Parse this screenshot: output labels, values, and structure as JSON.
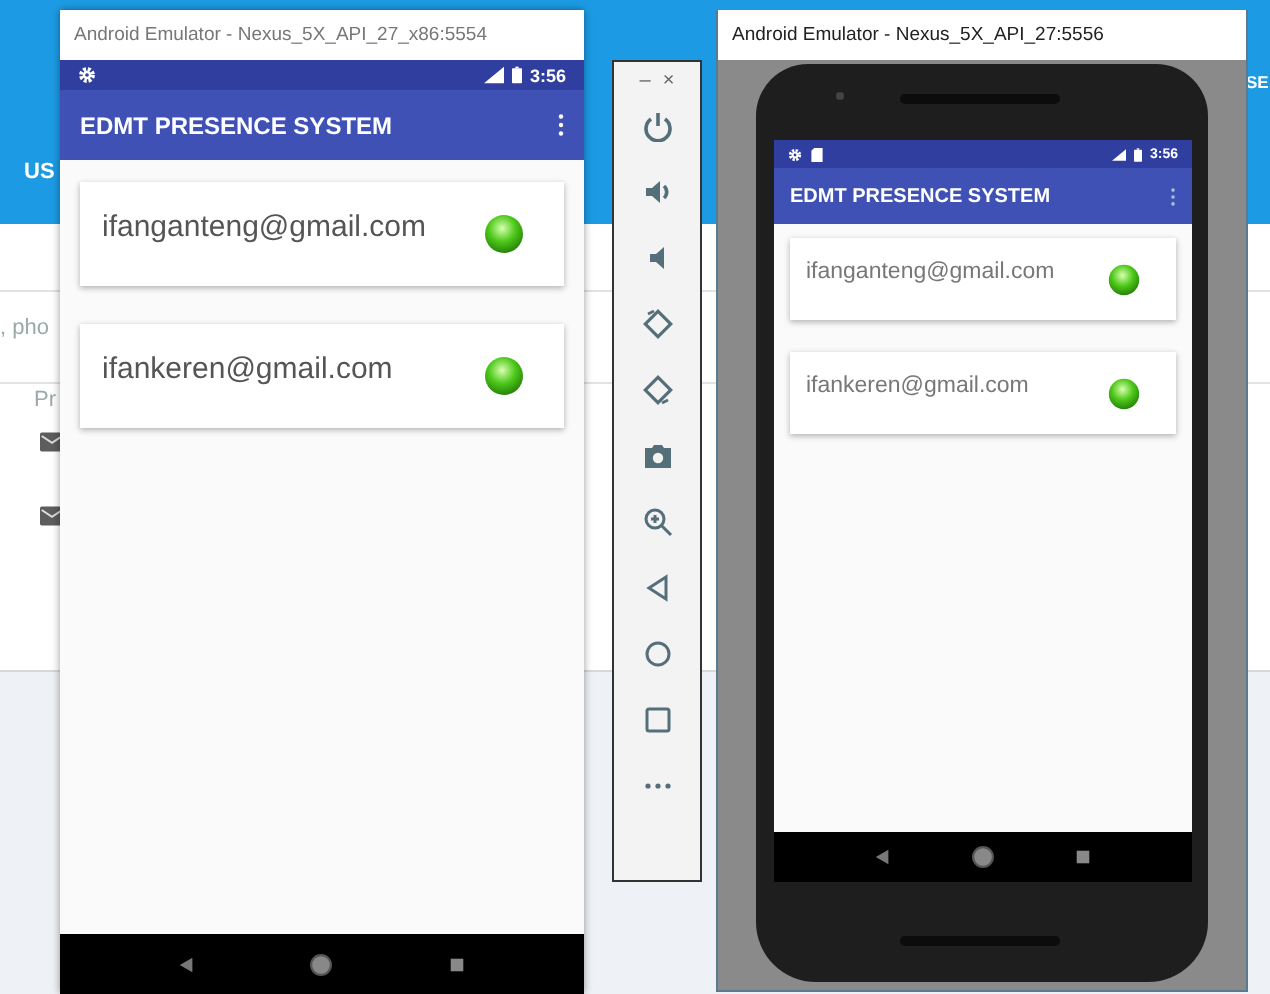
{
  "background_page": {
    "header_texts": [
      "US",
      "SE"
    ],
    "fragments": [
      ", pho",
      "Pr"
    ],
    "rows": [
      {
        "kind": "mail"
      },
      {
        "kind": "mail"
      }
    ]
  },
  "emulators": [
    {
      "kind": "plain",
      "title": "Android Emulator - Nexus_5X_API_27_x86:5554",
      "status_icons": [
        {
          "kind": "settings"
        }
      ],
      "time": "3:56",
      "app_title": "EDMT PRESENCE SYSTEM",
      "users": [
        {
          "email": "ifanganteng@gmail.com",
          "online": true
        },
        {
          "email": "ifankeren@gmail.com",
          "online": true
        }
      ]
    },
    {
      "kind": "skin",
      "title": "Android Emulator - Nexus_5X_API_27:5556",
      "status_icons": [
        {
          "kind": "settings"
        },
        {
          "kind": "sd_card"
        }
      ],
      "time": "3:56",
      "app_title": "EDMT PRESENCE SYSTEM",
      "users": [
        {
          "email": "ifanganteng@gmail.com",
          "online": true
        },
        {
          "email": "ifankeren@gmail.com",
          "online": true
        }
      ]
    }
  ],
  "toolbar": {
    "window_controls": [
      "–",
      "×"
    ],
    "buttons": [
      {
        "kind": "power"
      },
      {
        "kind": "volume_up"
      },
      {
        "kind": "volume_down"
      },
      {
        "kind": "rotate_left"
      },
      {
        "kind": "rotate_right"
      },
      {
        "kind": "screenshot"
      },
      {
        "kind": "zoom"
      },
      {
        "kind": "back"
      },
      {
        "kind": "home"
      },
      {
        "kind": "overview"
      },
      {
        "kind": "more"
      }
    ]
  }
}
